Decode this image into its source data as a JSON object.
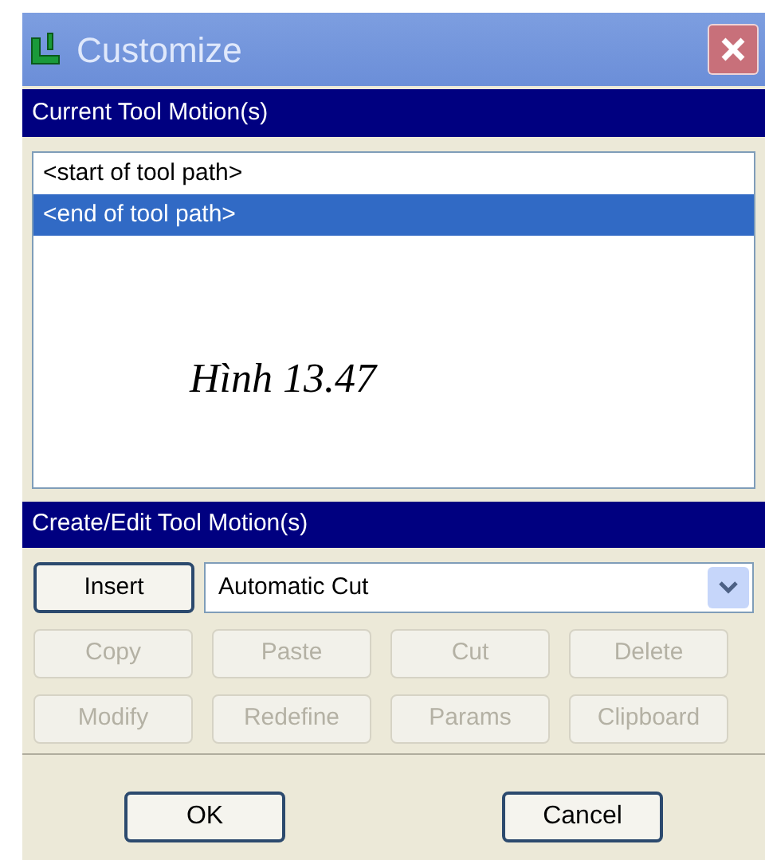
{
  "window": {
    "title": "Customize"
  },
  "current_motions": {
    "header": "Current Tool Motion(s)",
    "items": [
      {
        "label": "<start of tool path>",
        "selected": false
      },
      {
        "label": "<end of tool path>",
        "selected": true
      }
    ],
    "caption": "Hình 13.47"
  },
  "create_edit": {
    "header": "Create/Edit Tool Motion(s)",
    "insert_button": "Insert",
    "motion_type": {
      "value": "Automatic Cut"
    },
    "buttons": [
      {
        "label": "Copy",
        "disabled": true
      },
      {
        "label": "Paste",
        "disabled": true
      },
      {
        "label": "Cut",
        "disabled": true
      },
      {
        "label": "Delete",
        "disabled": true
      },
      {
        "label": "Modify",
        "disabled": true
      },
      {
        "label": "Redefine",
        "disabled": true
      },
      {
        "label": "Params",
        "disabled": true
      },
      {
        "label": "Clipboard",
        "disabled": true
      }
    ]
  },
  "footer_buttons": [
    "OK",
    "Cancel"
  ]
}
